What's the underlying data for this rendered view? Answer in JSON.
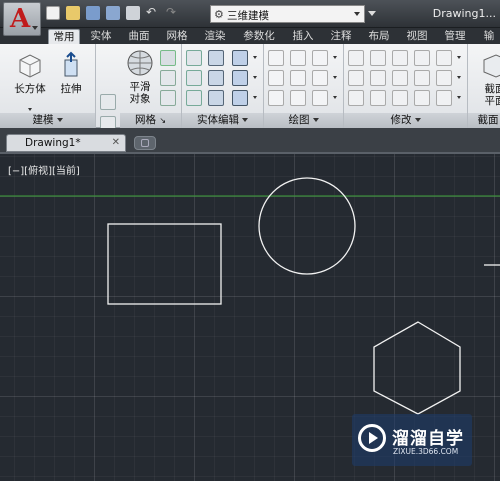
{
  "app": {
    "document_title": "Drawing1..."
  },
  "workspace": {
    "value": "三维建模"
  },
  "tabs": [
    "常用",
    "实体",
    "曲面",
    "网格",
    "渲染",
    "参数化",
    "插入",
    "注释",
    "布局",
    "视图",
    "管理",
    "输"
  ],
  "ribbon": {
    "panels": [
      {
        "label": "建模",
        "buttons": [
          "长方体",
          "拉伸"
        ]
      },
      {
        "label": "网格",
        "buttons": [
          "平滑对象"
        ]
      },
      {
        "label": "实体编辑"
      },
      {
        "label": "绘图"
      },
      {
        "label": "修改"
      },
      {
        "label": "截面",
        "buttons": [
          "截面平面"
        ]
      }
    ]
  },
  "file_tab": {
    "label": "Drawing1*"
  },
  "viewport": {
    "label": "[−][俯视][当前]"
  },
  "watermark": {
    "title": "溜溜自学",
    "subtitle": "ZIXUE.3D66.COM"
  },
  "colors": {
    "canvas": "#252a31",
    "ucs_line": "#3a8a3a",
    "app_red": "#c01b1b"
  }
}
